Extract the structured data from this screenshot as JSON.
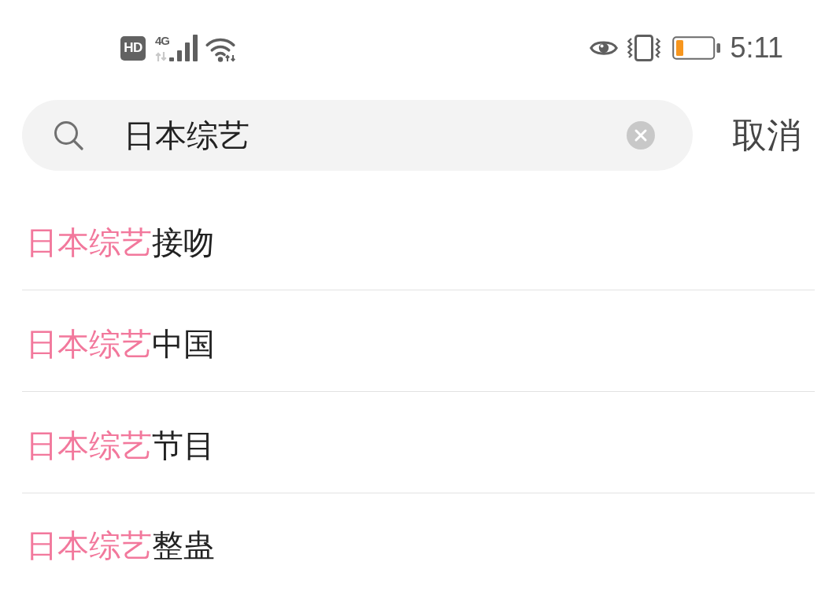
{
  "status_bar": {
    "hd": "HD",
    "network": "4G",
    "time": "5:11"
  },
  "search": {
    "query": "日本综艺",
    "cancel": "取消"
  },
  "suggestions": [
    {
      "match": "日本综艺",
      "rest": "接吻"
    },
    {
      "match": "日本综艺",
      "rest": "中国"
    },
    {
      "match": "日本综艺",
      "rest": "节目"
    },
    {
      "match": "日本综艺",
      "rest": "整蛊"
    }
  ]
}
